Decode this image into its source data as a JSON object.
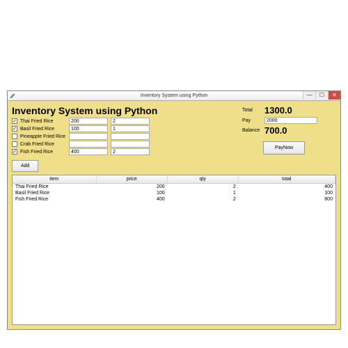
{
  "window": {
    "title": "Inventory System using Python",
    "buttons": {
      "minimize": "—",
      "maximize": "☐",
      "close": "✕"
    }
  },
  "heading": "Inventory System using Python",
  "items": [
    {
      "name": "Thai Fried Rice",
      "checked": true,
      "price": "200",
      "qty": "2"
    },
    {
      "name": "Basil Fried Rice",
      "checked": true,
      "price": "100",
      "qty": "1"
    },
    {
      "name": "Pineapple Fried Rice",
      "checked": false,
      "price": "",
      "qty": ""
    },
    {
      "name": "Crab Fried Rice",
      "checked": false,
      "price": "",
      "qty": ""
    },
    {
      "name": "Fish Fried Rice",
      "checked": true,
      "price": "400",
      "qty": "2"
    }
  ],
  "add_label": "Add",
  "summary": {
    "total_label": "Total",
    "total": "1300.0",
    "pay_label": "Pay",
    "pay": "2000",
    "balance_label": "Balance",
    "balance": "700.0",
    "paynow_label": "PayNow"
  },
  "table": {
    "headers": {
      "item": "item",
      "price": "price",
      "qty": "qty",
      "total": "total"
    },
    "rows": [
      {
        "item": "Thai Fried Rice",
        "price": "200",
        "qty": "2",
        "total": "400"
      },
      {
        "item": "Basil Fried Rice",
        "price": "100",
        "qty": "1",
        "total": "100"
      },
      {
        "item": "Fish Fried Rice",
        "price": "400",
        "qty": "2",
        "total": "800"
      }
    ]
  }
}
